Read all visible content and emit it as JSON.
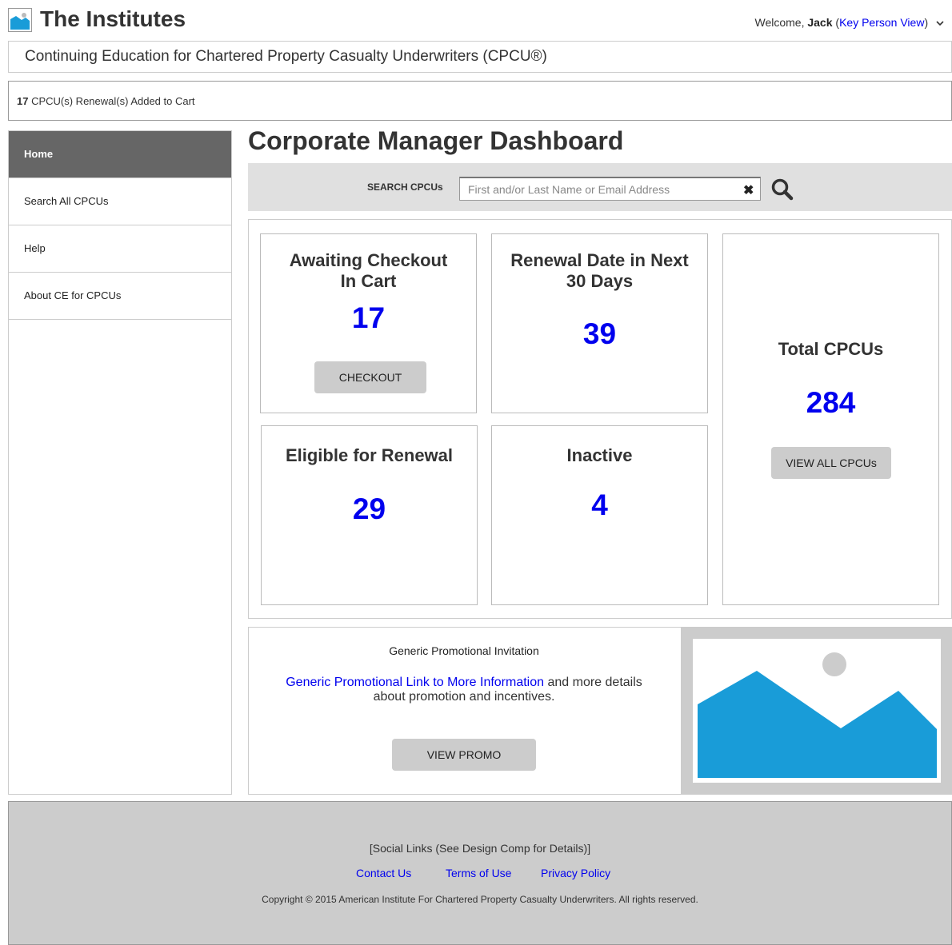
{
  "header": {
    "brand": "The Institutes",
    "welcome_prefix": "Welcome, ",
    "user_name": "Jack",
    "open_paren": " (",
    "view_link": "Key Person View",
    "close_paren": ")",
    "subtitle": "Continuing Education for Chartered Property Casualty Underwriters (CPCU®)"
  },
  "cart_notice": {
    "count": "17",
    "message": " CPCU(s) Renewal(s) Added to Cart"
  },
  "sidebar": {
    "items": [
      {
        "label": "Home",
        "active": true
      },
      {
        "label": "Search All CPCUs"
      },
      {
        "label": "Help"
      },
      {
        "label": "About CE for CPCUs"
      }
    ]
  },
  "main": {
    "title": "Corporate Manager Dashboard",
    "search": {
      "label": "SEARCH CPCUs",
      "placeholder": "First and/or Last Name or Email Address",
      "value": ""
    },
    "cards": {
      "awaiting": {
        "title_line1": "Awaiting Checkout",
        "title_line2": "In Cart",
        "value": "17",
        "button": "CHECKOUT"
      },
      "renewal_next": {
        "title_line1": "Renewal Date in Next",
        "title_line2": "30 Days",
        "value": "39"
      },
      "total": {
        "title": "Total CPCUs",
        "value": "284",
        "button": "VIEW ALL CPCUs"
      },
      "eligible": {
        "title": "Eligible for Renewal",
        "value": "29"
      },
      "inactive": {
        "title": "Inactive",
        "value": "4"
      }
    }
  },
  "promo": {
    "heading": "Generic Promotional Invitation",
    "link_text": "Generic Promotional Link to More Information",
    "text_after": " and more details about promotion and incentives.",
    "button": "VIEW PROMO"
  },
  "footer": {
    "social": "[Social Links (See Design Comp for Details)]",
    "links": {
      "contact": "Contact Us",
      "terms": "Terms of Use",
      "privacy": "Privacy Policy"
    },
    "copyright": "Copyright © 2015 American Institute For Chartered Property Casualty Underwriters. All rights reserved."
  },
  "colors": {
    "accent_blue": "#0000ee",
    "image_blue": "#199cd8",
    "active_nav": "#666666"
  }
}
